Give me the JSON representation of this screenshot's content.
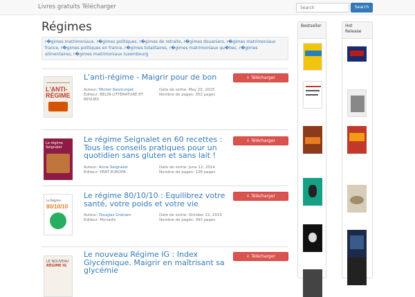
{
  "navbar": {
    "brand": "Livres gratuits Télécharger",
    "search_placeholder": "Search",
    "search_button": "Search"
  },
  "page": {
    "title": "Régimes"
  },
  "tags": [
    "r�gimes matrimoniaux,",
    "r�gimes politiques,",
    "r�gimes de retraite,",
    "r�gimes douaniers,",
    "r�gimes matrimoniaux",
    "france,",
    "r�gimes politiques en france,",
    "r�gimes totalitaires,",
    "r�gimes matrimoniaux qu�bec,",
    "r�gimes",
    "alimentaires,",
    "r�gimes matrimoniaux luxembourg"
  ],
  "labels": {
    "author": "Auteur:",
    "editor": "Editeur:",
    "release": "Date de sortie:",
    "pages": "Nombre de pages:",
    "download": "Télécharger"
  },
  "books": [
    {
      "title": "L'anti-régime - Maigrir pour de bon",
      "author": "Michel Desmurget",
      "editor": "BELIN LITTERATURE ET REVUES",
      "date": "May 20, 2015",
      "pages": "352 pages"
    },
    {
      "title": "Le régime Seignalet en 60 recettes : Tous les conseils pratiques pour un quotidien sans gluten et sans lait !",
      "author": "Anne Seignalet",
      "editor": "PRAT EUROPA",
      "date": "June 12, 2014",
      "pages": "128 pages"
    },
    {
      "title": "Le régime 80/10/10 : Equilibrez votre santé, votre poids et votre vie",
      "author": "Douglas Graham",
      "editor": "Myriadis",
      "date": "October 22, 2015",
      "pages": "393 pages"
    },
    {
      "title": "Le nouveau Régime IG : Index Glycémique. Maigrir en maîtrisant sa glycémie",
      "author": "",
      "editor": "",
      "date": "",
      "pages": ""
    }
  ],
  "sidebar": {
    "bestseller": "Bestseller",
    "hot_release": "Hot Release"
  },
  "colors": {
    "link": "#337ab7",
    "danger": "#d9534f",
    "primary": "#337ab7"
  }
}
